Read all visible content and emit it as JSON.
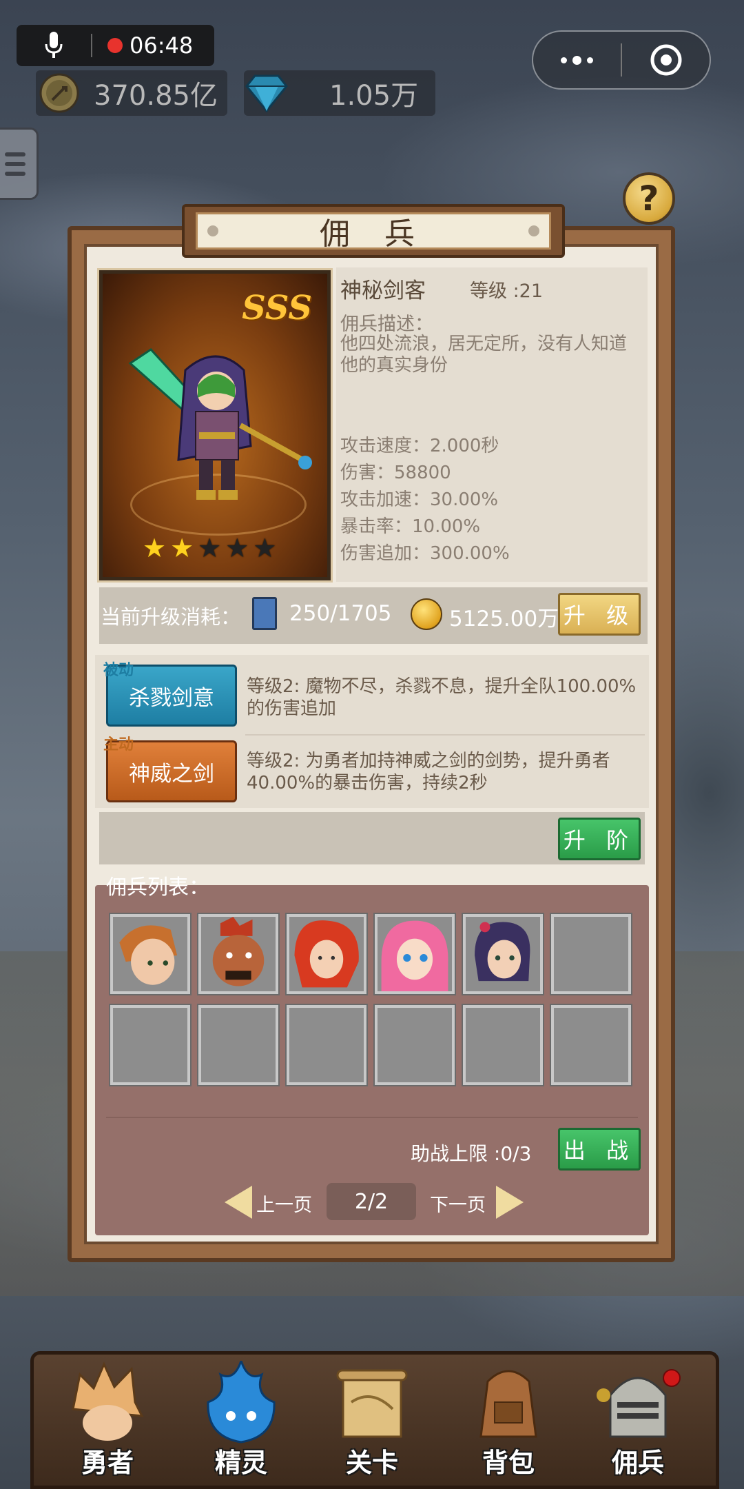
{
  "status_bar": {
    "time": "06:48"
  },
  "resources": {
    "gold": "370.85亿",
    "gems": "1.05万"
  },
  "panel": {
    "title": "佣 兵"
  },
  "hero": {
    "rank": "SSS",
    "stars_filled": 2,
    "stars_total": 5,
    "name": "神秘剑客",
    "level": "等级 :21",
    "desc_label": "佣兵描述：",
    "desc": "他四处流浪，居无定所，没有人知道他的真实身份",
    "stats": [
      "攻击速度：2.000秒",
      "伤害：58800",
      "攻击加速：30.00%",
      "暴击率：10.00%",
      "伤害追加：300.00%"
    ]
  },
  "upgrade": {
    "label": "当前升级消耗：",
    "books": "250/1705",
    "gold": "5125.00万",
    "button": "升 级"
  },
  "skills": [
    {
      "tag": "被动",
      "name": "杀戮剑意",
      "desc": "等级2:  魔物不尽，杀戮不息，提升全队100.00%的伤害追加"
    },
    {
      "tag": "主动",
      "name": "神威之剑",
      "desc": "等级2:  为勇者加持神威之剑的剑势，提升勇者40.00%的暴击伤害，持续2秒"
    }
  ],
  "advance_button": "升 阶",
  "roster": {
    "title": "佣兵列表：",
    "deploy_limit": "助战上限 :0/3",
    "deploy_button": "出 战",
    "prev": "上一页",
    "next": "下一页",
    "page": "2/2"
  },
  "nav": [
    "勇者",
    "精灵",
    "关卡",
    "背包",
    "佣兵"
  ],
  "colors": {
    "gold_button": "#e6c46a",
    "green_button": "#34ad56",
    "roster_bg": "#95706a"
  }
}
